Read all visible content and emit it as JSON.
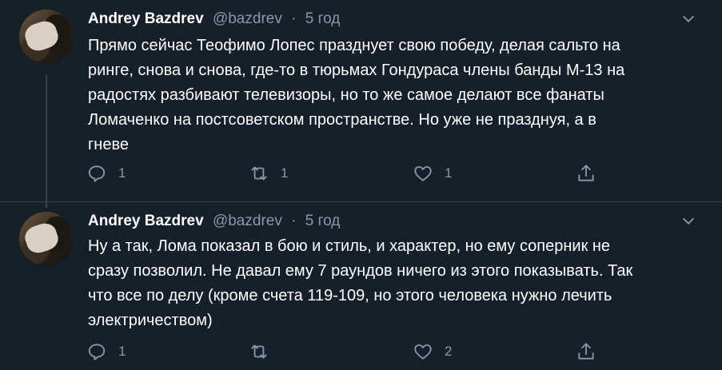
{
  "tweets": [
    {
      "author_name": "Andrey Bazdrev",
      "handle": "@bazdrev",
      "separator": "·",
      "time": "5 год",
      "text_lines": [
        "Прямо сейчас Теофимо Лопес празднует свою победу, делая сальто на",
        "ринге, снова и снова, где-то в тюрьмах Гондураса члены банды М-13 на",
        "радостях разбивают телевизоры, но то же самое делают все фанаты",
        "Ломаченко на постсоветском пространстве. Но уже не празднуя, а в",
        "гневе"
      ],
      "reply_count": "1",
      "retweet_count": "1",
      "like_count": "1",
      "share_count": ""
    },
    {
      "author_name": "Andrey Bazdrev",
      "handle": "@bazdrev",
      "separator": "·",
      "time": "5 год",
      "text_lines": [
        "Ну а так, Лома показал в бою и стиль, и характер, но ему соперник не",
        "сразу позволил. Не давал ему 7 раундов ничего из этого показывать. Так",
        "что все по делу (кроме счета 119-109, но этого человека нужно лечить",
        "электричеством)"
      ],
      "reply_count": "1",
      "retweet_count": "",
      "like_count": "2",
      "share_count": ""
    }
  ],
  "icons": {
    "reply": "reply-icon",
    "retweet": "retweet-icon",
    "like": "heart-icon",
    "share": "share-icon",
    "more": "chevron-down-icon"
  },
  "colors": {
    "background": "#15202b",
    "secondary_text": "#8899a6",
    "divider": "#38444d",
    "primary_text": "#ffffff"
  }
}
